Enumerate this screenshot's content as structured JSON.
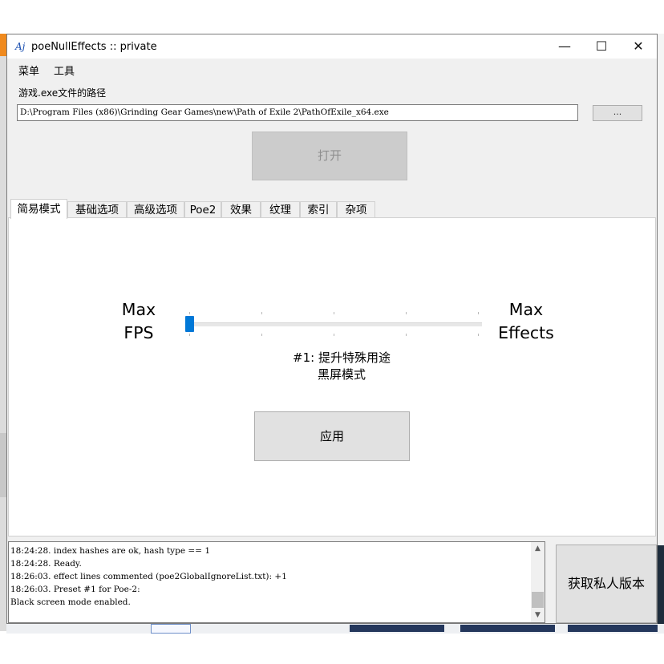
{
  "window": {
    "title": "poeNullEffects :: private",
    "icon_text": "Aj",
    "controls": {
      "minimize": "—",
      "maximize": "☐",
      "close": "✕"
    }
  },
  "menu": {
    "items": [
      "菜单",
      "工具"
    ]
  },
  "path": {
    "label": "游戏.exe文件的路径",
    "value": "D:\\Program Files (x86)\\Grinding Gear Games\\new\\Path of Exile 2\\PathOfExile_x64.exe",
    "browse_label": "..."
  },
  "open_button": "打开",
  "tabs": [
    "简易模式",
    "基础选项",
    "高级选项",
    "Poe2",
    "效果",
    "纹理",
    "索引",
    "杂项"
  ],
  "active_tab": 0,
  "simple_mode": {
    "left_label": [
      "Max",
      "FPS"
    ],
    "right_label": [
      "Max",
      "Effects"
    ],
    "slider": {
      "value": 0,
      "min": 0,
      "max": 4
    },
    "preset_lines": [
      "#1: 提升特殊用途",
      "黑屏模式"
    ],
    "apply_label": "应用"
  },
  "log": {
    "lines": [
      "18:24:28. index hashes are ok, hash type == 1",
      "18:24:28. Ready.",
      "18:26:03. effect lines commented (poe2GlobalIgnoreList.txt): +1",
      "18:26:03. Preset #1 for Poe-2:",
      "Black screen mode enabled."
    ]
  },
  "private_button": "获取私人版本"
}
